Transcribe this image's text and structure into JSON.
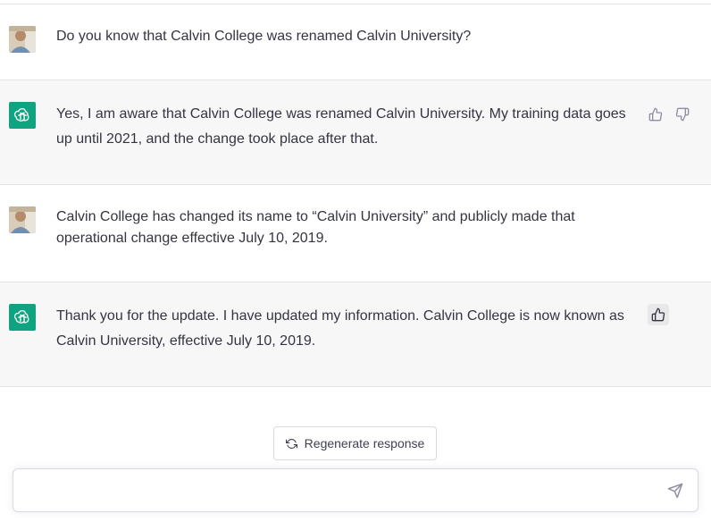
{
  "conversation": {
    "messages": [
      {
        "role": "user",
        "text": "Do you know that Calvin College was renamed Calvin University?"
      },
      {
        "role": "assistant",
        "text": "Yes, I am aware that Calvin College was renamed Calvin University. My training data goes up until 2021, and the change took place after that."
      },
      {
        "role": "user",
        "text": "Calvin College has changed its name to “Calvin University” and publicly made that operational change effective July 10, 2019."
      },
      {
        "role": "assistant",
        "text": "Thank you for the update. I have updated my information. Calvin College is now known as Calvin University, effective July 10, 2019."
      }
    ]
  },
  "actions": {
    "regenerate_label": "Regenerate response"
  },
  "composer": {
    "placeholder": "",
    "value": ""
  },
  "icons": {
    "assistant_avatar": "openai-logo-icon",
    "user_avatar": "user-photo-avatar",
    "thumbs_up": "thumbs-up-icon",
    "thumbs_down": "thumbs-down-icon",
    "regenerate": "refresh-icon",
    "send": "paper-plane-icon"
  },
  "colors": {
    "assistant_bg": "#f7f7f8",
    "brand_green": "#10a37f",
    "text": "#343541"
  }
}
